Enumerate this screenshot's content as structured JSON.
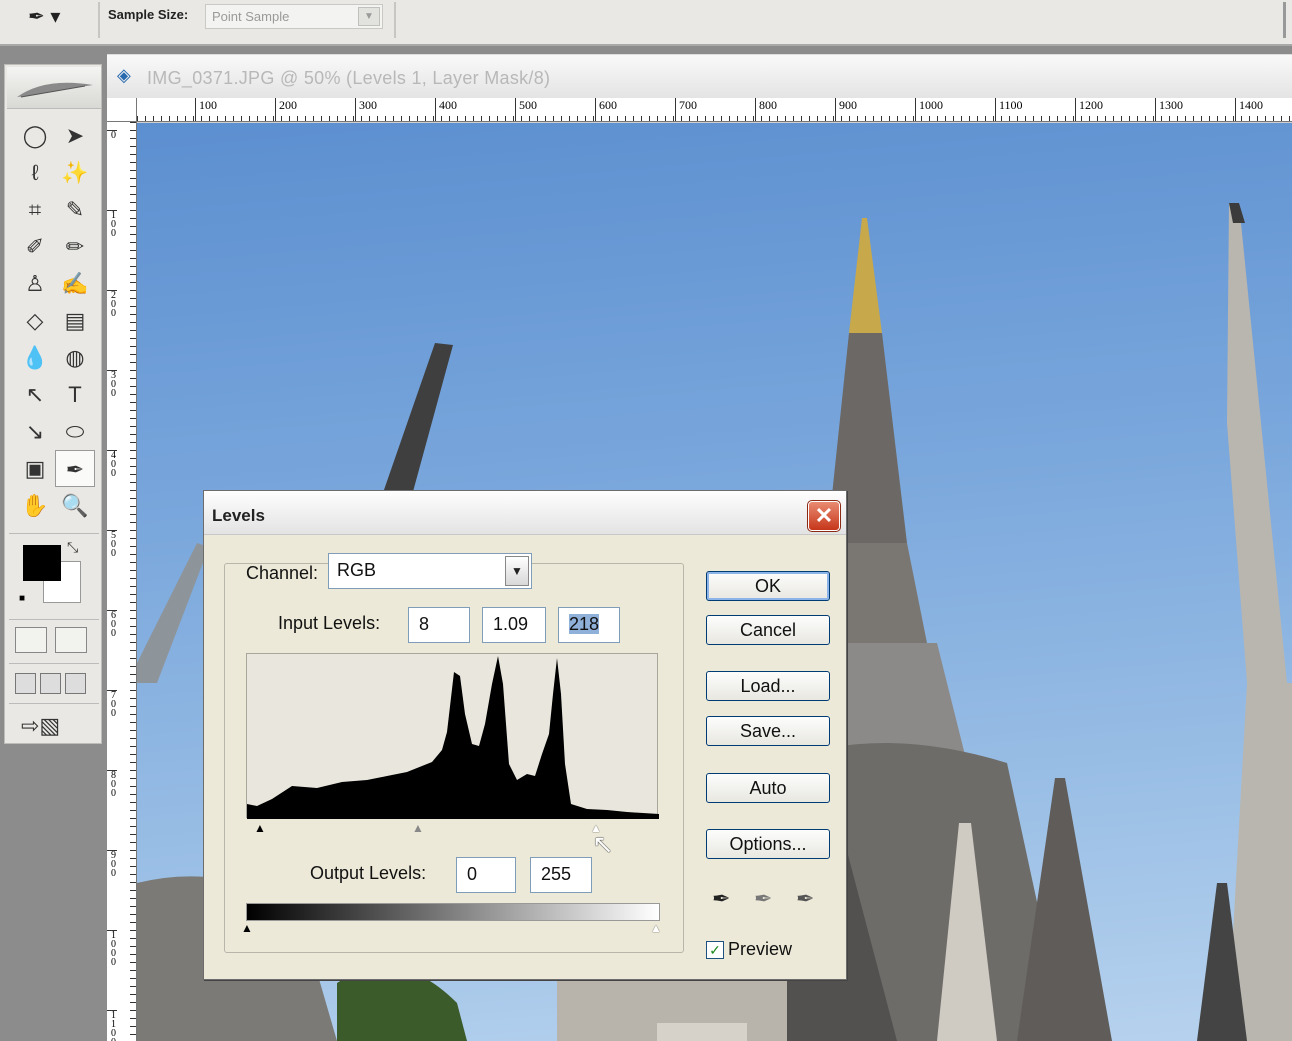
{
  "options_bar": {
    "tool_icon": "eyedropper-icon",
    "sample_label": "Sample Size:",
    "sample_value": "Point Sample"
  },
  "document": {
    "title": "IMG_0371.JPG @ 50% (Levels 1, Layer Mask/8)",
    "ruler_h": [
      "100",
      "200",
      "300",
      "400",
      "500",
      "600",
      "700",
      "800",
      "900",
      "1000",
      "1100",
      "1200",
      "1300",
      "1400"
    ],
    "ruler_v": [
      "0",
      "100",
      "200",
      "300",
      "400",
      "500",
      "600",
      "700",
      "800",
      "900",
      "1000",
      "1100"
    ]
  },
  "levels": {
    "title": "Levels",
    "channel_label": "Channel:",
    "channel_value": "RGB",
    "input_label": "Input Levels:",
    "input_black": "8",
    "input_gamma": "1.09",
    "input_white": "218",
    "output_label": "Output Levels:",
    "output_black": "0",
    "output_white": "255",
    "buttons": {
      "ok": "OK",
      "cancel": "Cancel",
      "load": "Load...",
      "save": "Save...",
      "auto": "Auto",
      "options": "Options..."
    },
    "preview_label": "Preview",
    "preview_checked": true
  }
}
